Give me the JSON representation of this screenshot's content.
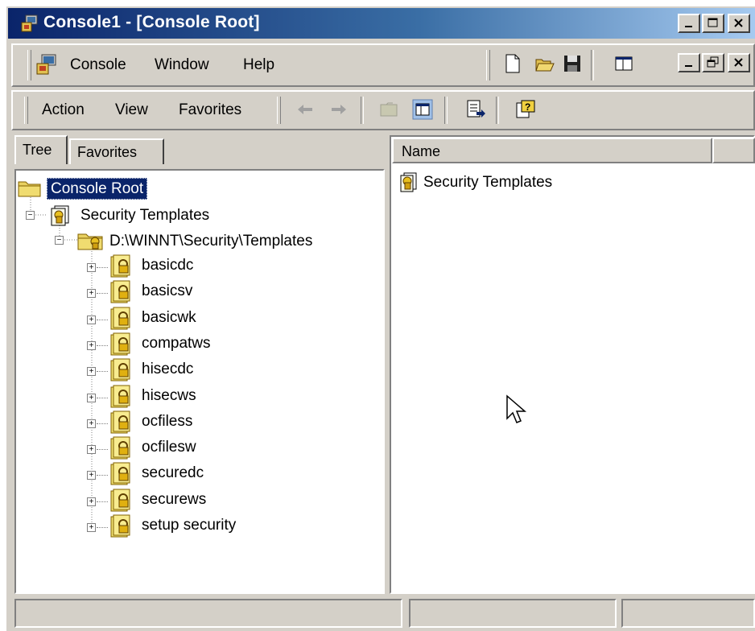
{
  "window": {
    "title": "Console1 - [Console Root]"
  },
  "menubar": {
    "items": [
      "Console",
      "Window",
      "Help"
    ]
  },
  "actionbar": {
    "items": [
      "Action",
      "View",
      "Favorites"
    ]
  },
  "left_pane": {
    "tabs": [
      "Tree",
      "Favorites"
    ],
    "root": "Console Root",
    "snapin": "Security Templates",
    "folder": "D:\\WINNT\\Security\\Templates",
    "templates": [
      "basicdc",
      "basicsv",
      "basicwk",
      "compatws",
      "hisecdc",
      "hisecws",
      "ocfiless",
      "ocfilesw",
      "securedc",
      "securews",
      "setup security"
    ]
  },
  "right_pane": {
    "column_header": "Name",
    "items": [
      "Security Templates"
    ]
  },
  "colors": {
    "titlebar_start": "#0a246a",
    "titlebar_end": "#a6caf0",
    "selection": "#0a246a",
    "face": "#d4d0c8"
  }
}
